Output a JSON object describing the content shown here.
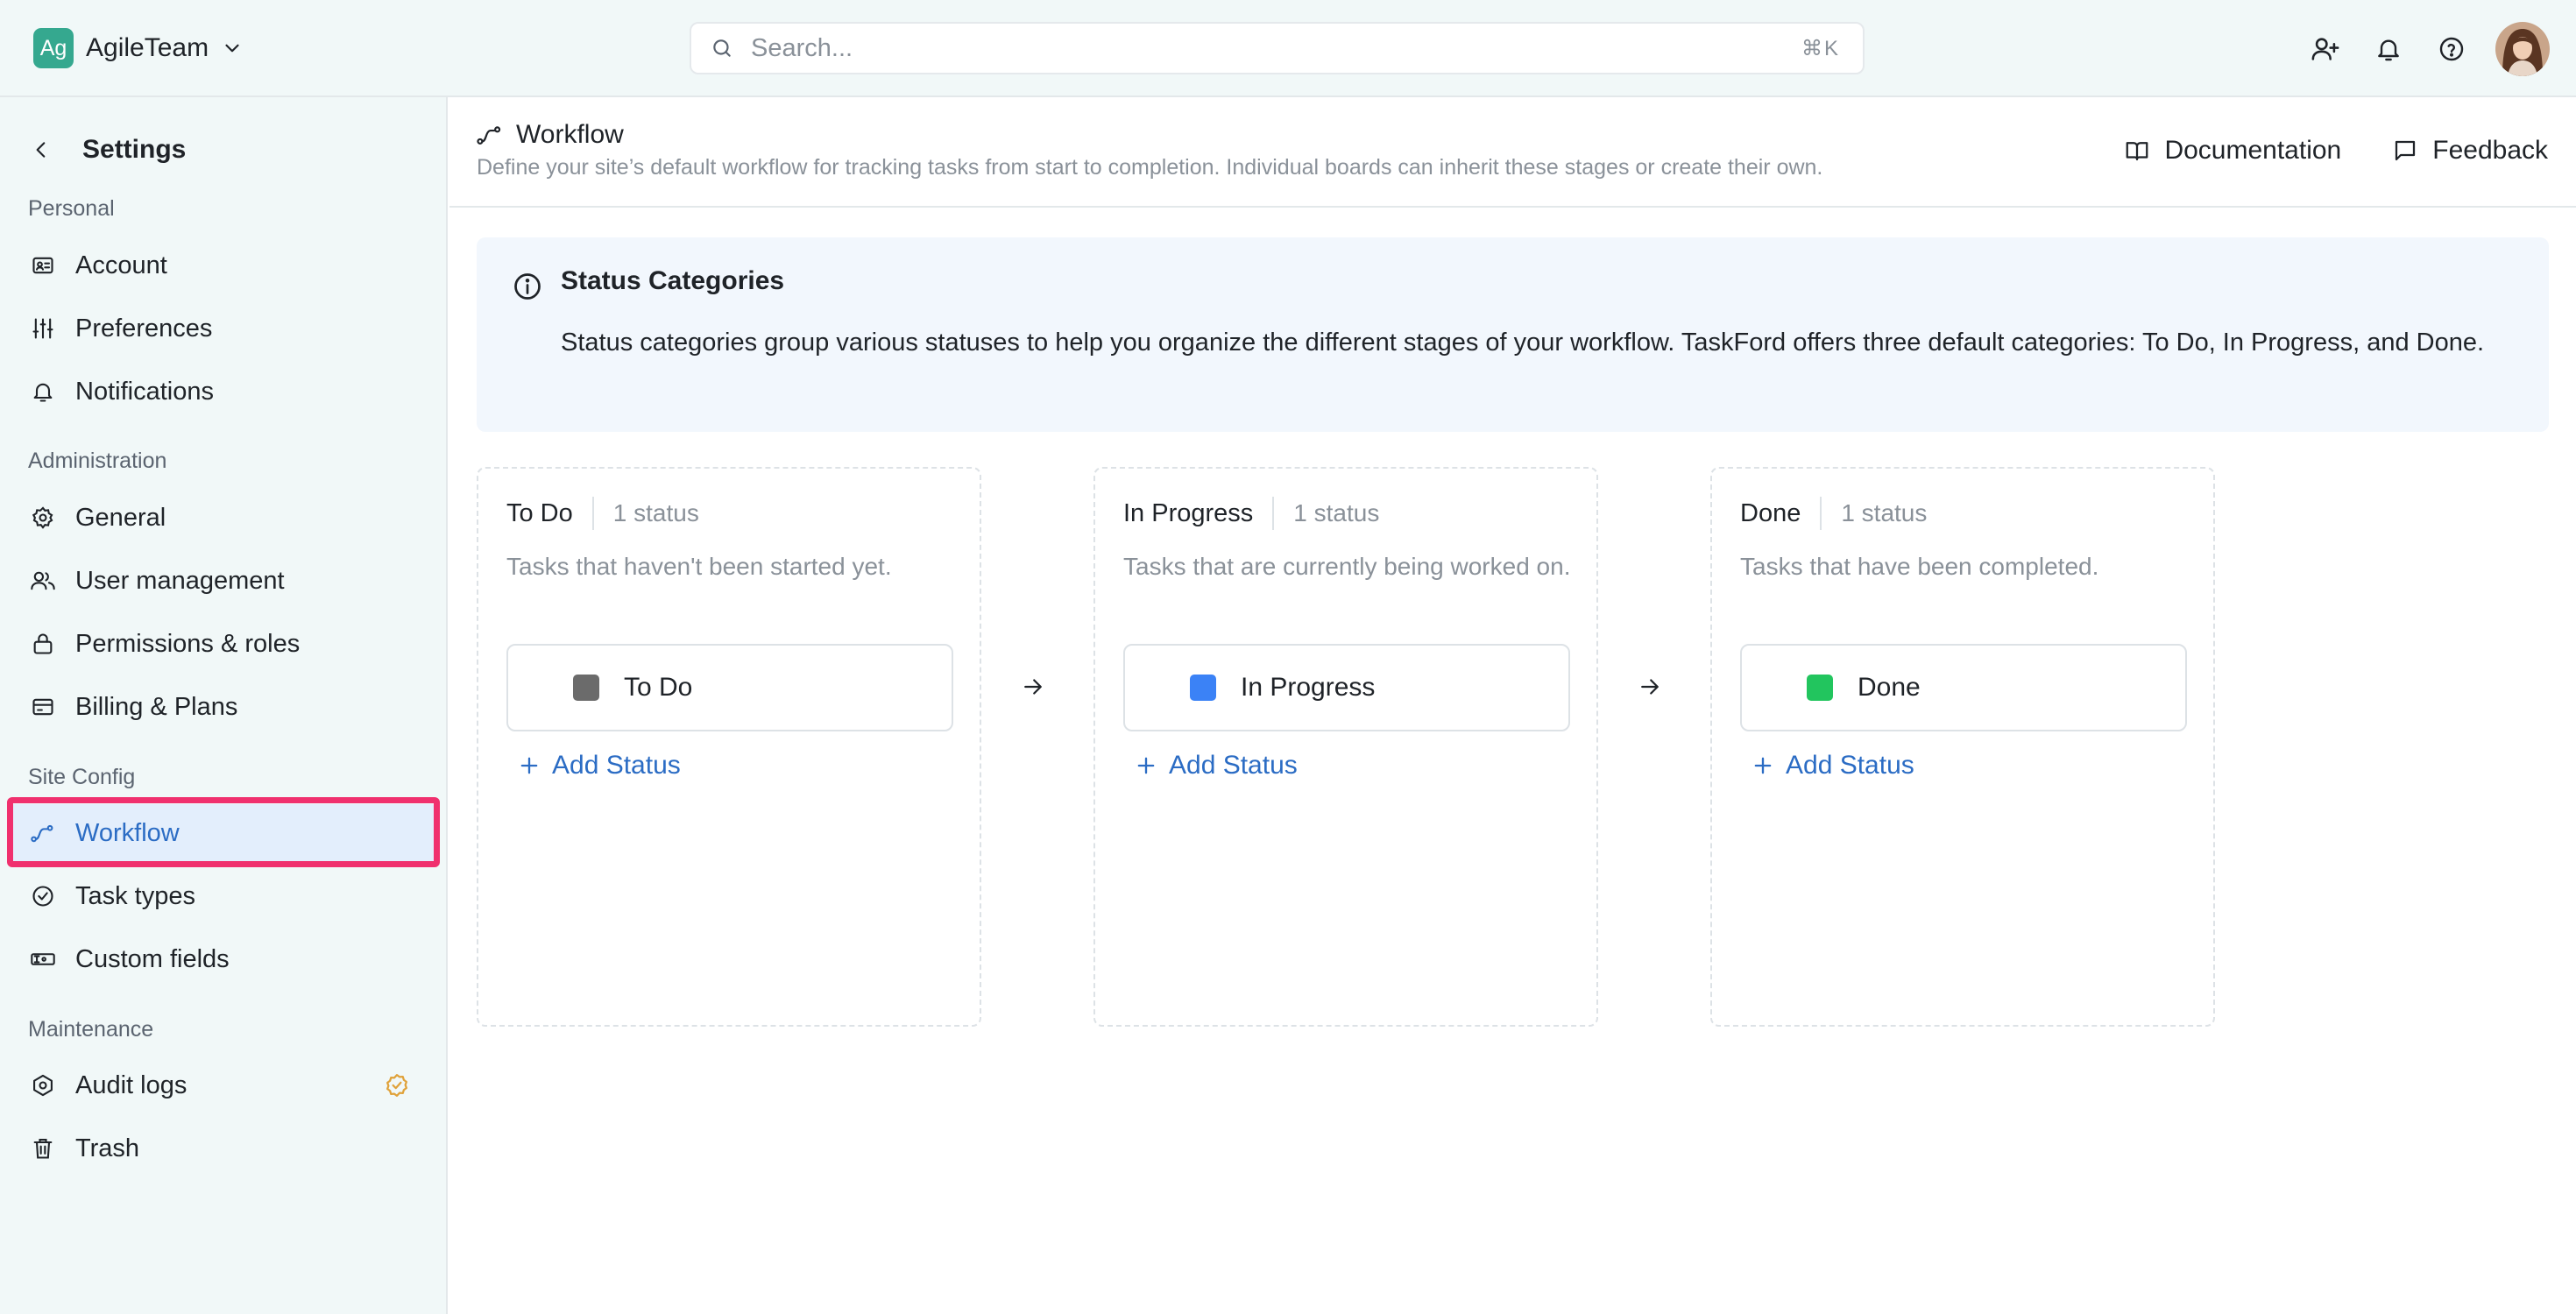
{
  "topbar": {
    "team_logo": "Ag",
    "team_name": "AgileTeam",
    "search_placeholder": "Search...",
    "search_shortcut": "⌘K",
    "icons": [
      "invite-user-icon",
      "bell-icon",
      "help-icon",
      "avatar"
    ]
  },
  "sidebar": {
    "title": "Settings",
    "sections": {
      "personal": "Personal",
      "administration": "Administration",
      "site_config": "Site Config",
      "maintenance": "Maintenance"
    },
    "items": {
      "account": "Account",
      "preferences": "Preferences",
      "notifications": "Notifications",
      "general": "General",
      "user_management": "User management",
      "permissions": "Permissions & roles",
      "billing": "Billing & Plans",
      "workflow": "Workflow",
      "task_types": "Task types",
      "custom_fields": "Custom fields",
      "audit_logs": "Audit logs",
      "trash": "Trash"
    },
    "active_item": "workflow"
  },
  "page": {
    "title": "Workflow",
    "description": "Define your site’s default workflow for tracking tasks from start to completion. Individual boards can inherit these stages or create their own.",
    "documentation_label": "Documentation",
    "feedback_label": "Feedback"
  },
  "info": {
    "title": "Status Categories",
    "text": "Status categories group various statuses to help you organize the different stages of your workflow. TaskFord offers three default categories: To Do, In Progress, and Done."
  },
  "columns": [
    {
      "name": "To Do",
      "count": "1 status",
      "description": "Tasks that haven't been started yet.",
      "status": "To Do",
      "color": "#6b6b6b",
      "add_label": "Add Status"
    },
    {
      "name": "In Progress",
      "count": "1 status",
      "description": "Tasks that are currently being worked on.",
      "status": "In Progress",
      "color": "#3b82f6",
      "add_label": "Add Status"
    },
    {
      "name": "Done",
      "count": "1 status",
      "description": "Tasks that have been completed.",
      "status": "Done",
      "color": "#22c55e",
      "add_label": "Add Status"
    }
  ],
  "colors": {
    "accent": "#2b6cc4",
    "highlight": "#f0306e",
    "brand": "#35a88f",
    "audit_badge": "#e0a23a"
  }
}
